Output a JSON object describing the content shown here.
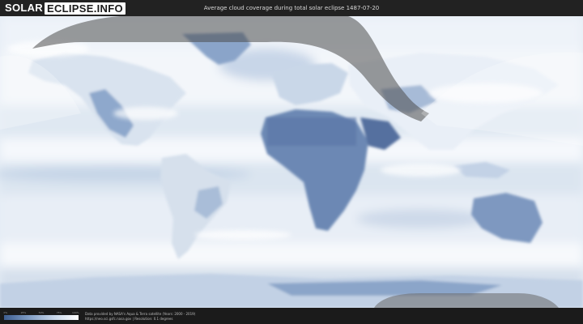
{
  "header": {
    "logo_part1": "SOLAR",
    "logo_part2": "ECLIPSE.INFO",
    "title": "Average cloud coverage during total solar eclipse 1487-07-20"
  },
  "legend": {
    "ticks": [
      "0%",
      "25%",
      "50%",
      "75%",
      "100%"
    ],
    "colors": [
      "#3e5e91",
      "#7f9cc3",
      "#c7d6e9",
      "#ffffff"
    ]
  },
  "footer": {
    "credit_line1": "Data provided by NASA's Aqua & Terra satellite (Years: 2000 - 2019)",
    "credit_line2": "https://neo.sci.gsfc.nasa.gov | Resolution: 0.1 degrees"
  },
  "map": {
    "projection": "equirectangular",
    "eclipse_path_color": "#555555",
    "land_color": "#dde6f0",
    "cloudy_color": "#ffffff",
    "clear_color": "#4a6a9c"
  }
}
